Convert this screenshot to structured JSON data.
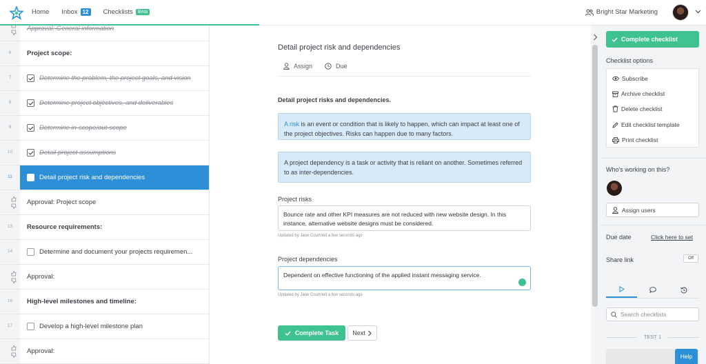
{
  "nav": {
    "home": "Home",
    "inbox": "Inbox",
    "inbox_count": "12",
    "checklists": "Checklists",
    "beta": "Beta",
    "org": "Bright Star Marketing"
  },
  "list": {
    "items": [
      {
        "num": "",
        "label": "Approval: General information",
        "type": "approval-done"
      },
      {
        "num": "6",
        "label": "Project scope:",
        "type": "heading"
      },
      {
        "num": "7",
        "label": "Determine the problem, the project goals, and vision",
        "type": "done"
      },
      {
        "num": "8",
        "label": "Determine project objectives, and deliverables",
        "type": "done"
      },
      {
        "num": "9",
        "label": "Determine in-scope/out-scope",
        "type": "done"
      },
      {
        "num": "10",
        "label": "Detail project assumptions",
        "type": "done"
      },
      {
        "num": "11",
        "label": "Detail project risk and dependencies",
        "type": "active"
      },
      {
        "num": "",
        "label": "Approval: Project scope",
        "type": "approval"
      },
      {
        "num": "13",
        "label": "Resource requirements:",
        "type": "heading"
      },
      {
        "num": "14",
        "label": "Determine and document your projects requiremen...",
        "type": "task"
      },
      {
        "num": "",
        "label": "Approval:",
        "type": "approval"
      },
      {
        "num": "16",
        "label": "High-level milestones and timeline:",
        "type": "heading"
      },
      {
        "num": "17",
        "label": "Develop a high-level milestone plan",
        "type": "task"
      },
      {
        "num": "",
        "label": "Approval:",
        "type": "approval"
      }
    ]
  },
  "task": {
    "title": "Detail project risk and dependencies",
    "assign": "Assign",
    "due": "Due",
    "section_title": "Detail project risks and dependencies.",
    "info1_link": "A risk",
    "info1_text": " is an event or condition that is likely to happen, which can impact at least one of the project objectives. Risks can happen due to many factors.",
    "info2_text": "A project dependency is a task or activity that is reliant on another. Sometimes referred to as inter-dependencies.",
    "risks_label": "Project risks",
    "risks_value": "Bounce rate and other KPI measures are not reduced with new website design. In this instance, alternative website designs must be considered.",
    "risks_updated": "Updated by Jane Courtnell a few seconds ago",
    "deps_label": "Project dependencies",
    "deps_value": "Dependent on effective functioning of the applied instant messaging service.",
    "deps_updated": "Updated by Jane Courtnell a few seconds ago",
    "complete_task": "Complete Task",
    "next": "Next"
  },
  "sidebar": {
    "complete_checklist": "Complete checklist",
    "options_title": "Checklist options",
    "options": {
      "subscribe": "Subscribe",
      "archive": "Archive checklist",
      "delete": "Delete checklist",
      "edit_template": "Edit checklist template",
      "print": "Print checklist"
    },
    "working_title": "Who's working on this?",
    "assign_users": "Assign users",
    "due_date_label": "Due date",
    "due_date_link": "Click here to set",
    "share_link_label": "Share link",
    "share_toggle": "Off",
    "search_placeholder": "Search checklists",
    "group_label": "TEST 1",
    "help": "Help"
  },
  "colors": {
    "accent_green": "#3ec28f",
    "accent_blue": "#2d8fd8",
    "info_bg": "#d8e9f7"
  }
}
